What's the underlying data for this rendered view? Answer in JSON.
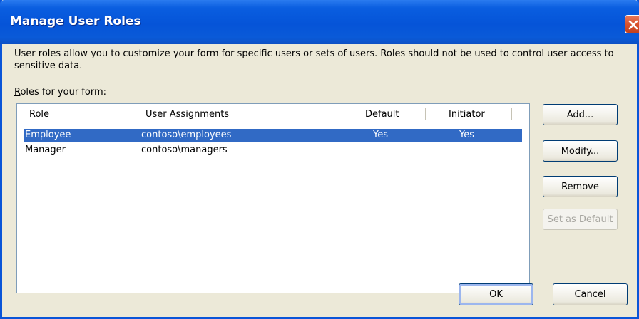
{
  "window": {
    "title": "Manage User Roles",
    "colors": {
      "titlebar": "#0554d8",
      "dialog_bg": "#ece9d8",
      "selection": "#316ac5",
      "close_button": "#d9532e"
    }
  },
  "description": "User roles allow you to customize your form for specific users or sets of users. Roles should not be used to control user access to sensitive data.",
  "roles_label": {
    "mnemonic": "R",
    "rest": "oles for your form:"
  },
  "table": {
    "columns": [
      "Role",
      "User Assignments",
      "Default",
      "Initiator"
    ],
    "rows": [
      {
        "role": "Employee",
        "assignments": "contoso\\employees",
        "default": "Yes",
        "initiator": "Yes",
        "selected": true
      },
      {
        "role": "Manager",
        "assignments": "contoso\\managers",
        "default": "",
        "initiator": "",
        "selected": false
      }
    ]
  },
  "buttons": {
    "add": "Add...",
    "modify": "Modify...",
    "remove": "Remove",
    "set_default": "Set as Default",
    "ok": "OK",
    "cancel": "Cancel"
  },
  "icons": {
    "close": "close-icon"
  }
}
